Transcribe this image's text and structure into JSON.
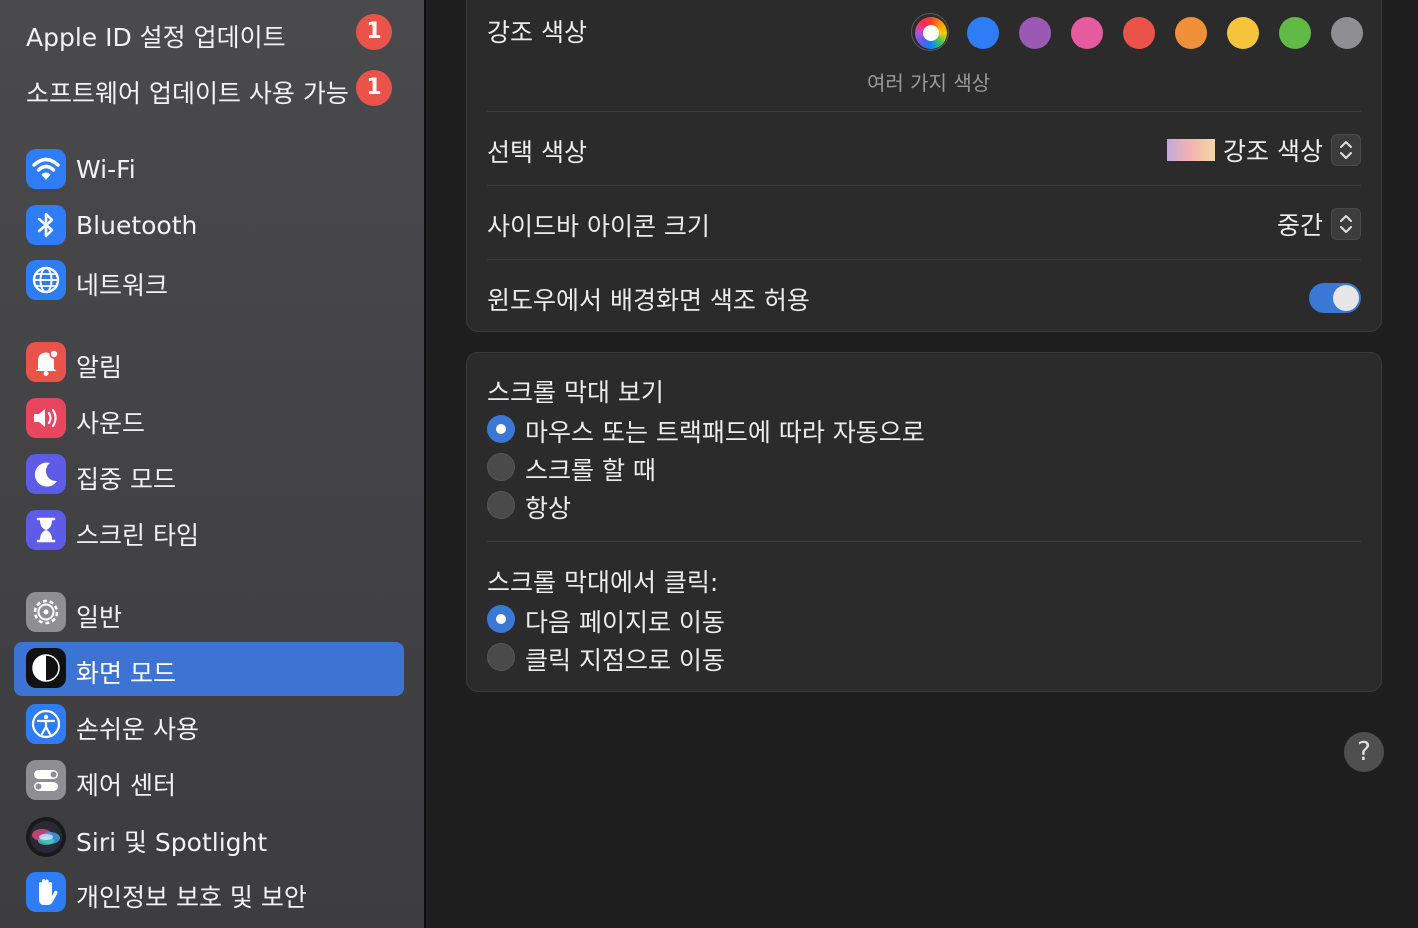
{
  "sidebar": {
    "updates": [
      {
        "label": "Apple ID 설정 업데이트",
        "badge": "1"
      },
      {
        "label": "소프트웨어 업데이트 사용 가능",
        "badge": "1"
      }
    ],
    "items": [
      {
        "label": "Wi-Fi",
        "icon": "wifi-icon",
        "color": "#2f7df6"
      },
      {
        "label": "Bluetooth",
        "icon": "bluetooth-icon",
        "color": "#2f7df6"
      },
      {
        "label": "네트워크",
        "icon": "globe-icon",
        "color": "#2f7df6"
      },
      {
        "label": "알림",
        "icon": "bell-icon",
        "color": "#e9534a"
      },
      {
        "label": "사운드",
        "icon": "speaker-icon",
        "color": "#e9455f"
      },
      {
        "label": "집중 모드",
        "icon": "moon-icon",
        "color": "#5e5ce6"
      },
      {
        "label": "스크린 타임",
        "icon": "hourglass-icon",
        "color": "#5e5ce6"
      },
      {
        "label": "일반",
        "icon": "gear-icon",
        "color": "#8e8e93"
      },
      {
        "label": "화면 모드",
        "icon": "appearance-icon",
        "color": "#111111",
        "selected": true
      },
      {
        "label": "손쉬운 사용",
        "icon": "accessibility-icon",
        "color": "#2f7df6"
      },
      {
        "label": "제어 센터",
        "icon": "control-center-icon",
        "color": "#8e8e93"
      },
      {
        "label": "Siri 및 Spotlight",
        "icon": "siri-icon",
        "color": "#222222"
      },
      {
        "label": "개인정보 보호 및 보안",
        "icon": "hand-icon",
        "color": "#2f7df6"
      }
    ]
  },
  "appearance": {
    "accent": {
      "label": "강조 색상",
      "caption": "여러 가지 색상",
      "colors": [
        "multicolor",
        "#2f7df6",
        "#9b59b6",
        "#e65aa0",
        "#e9534a",
        "#f0913a",
        "#f5c43c",
        "#62ba46",
        "#8e8e93"
      ]
    },
    "highlight": {
      "label": "선택 색상",
      "value": "강조 색상"
    },
    "sidebar_icon_size": {
      "label": "사이드바 아이콘 크기",
      "value": "중간"
    },
    "wallpaper_tinting": {
      "label": "윈도우에서 배경화면 색조 허용",
      "on": true
    }
  },
  "scrollbars": {
    "show_title": "스크롤 막대 보기",
    "show_options": [
      {
        "label": "마우스 또는 트랙패드에 따라 자동으로",
        "selected": true
      },
      {
        "label": "스크롤 할 때",
        "selected": false
      },
      {
        "label": "항상",
        "selected": false
      }
    ],
    "click_title": "스크롤 막대에서 클릭:",
    "click_options": [
      {
        "label": "다음 페이지로 이동",
        "selected": true
      },
      {
        "label": "클릭 지점으로 이동",
        "selected": false
      }
    ]
  },
  "help": {
    "label": "?"
  }
}
